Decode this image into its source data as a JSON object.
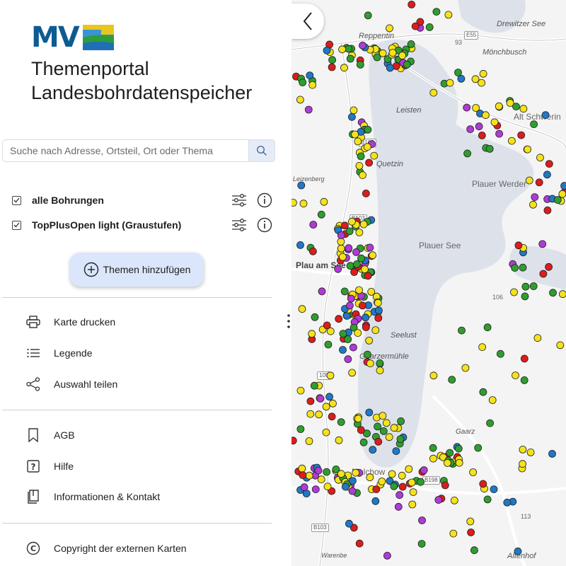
{
  "logo": {
    "text": "MV"
  },
  "header": {
    "title_line1": "Themenportal",
    "title_line2": "Landesbohrdatenspeicher"
  },
  "search": {
    "placeholder": "Suche nach Adresse, Ortsteil, Ort oder Thema",
    "icon": "search-icon"
  },
  "layers": [
    {
      "label": "alle Bohrungen",
      "checked": true
    },
    {
      "label": "TopPlusOpen light (Graustufen)",
      "checked": true
    }
  ],
  "add_button": {
    "label": "Themen hinzufügen"
  },
  "menu1": [
    {
      "label": "Karte drucken",
      "icon": "printer-icon"
    },
    {
      "label": "Legende",
      "icon": "list-icon"
    },
    {
      "label": "Auswahl teilen",
      "icon": "share-icon"
    }
  ],
  "menu2": [
    {
      "label": "AGB",
      "icon": "bookmark-icon"
    },
    {
      "label": "Hilfe",
      "icon": "help-icon"
    },
    {
      "label": "Informationen & Kontakt",
      "icon": "book-icon"
    }
  ],
  "menu3": [
    {
      "label": "Copyright der externen Karten",
      "icon": "copyright-icon"
    }
  ],
  "map": {
    "places": [
      {
        "text": "Drewitzer See"
      },
      {
        "text": "Mönchbusch"
      },
      {
        "text": "Alt Schwerin"
      },
      {
        "text": "Leisten"
      },
      {
        "text": "Quetzin"
      },
      {
        "text": "Plauer Werder"
      },
      {
        "text": "Plauer See"
      },
      {
        "text": "Plau am See"
      },
      {
        "text": "Seelust"
      },
      {
        "text": "Gaarzermühle"
      },
      {
        "text": "Malchow"
      },
      {
        "text": "Altenhof"
      },
      {
        "text": "Reppentin"
      },
      {
        "text": "Leizenberg"
      },
      {
        "text": "Warenbe"
      },
      {
        "text": "Gaarz"
      }
    ],
    "roads": [
      "E55",
      "B103",
      "B103",
      "B198",
      "B103",
      "109"
    ],
    "elevations": [
      "93",
      "106",
      "113"
    ],
    "colors": {
      "red": "#dd1c1c",
      "yellow": "#f5e21a",
      "green": "#2e9e2e",
      "blue": "#1f78c8",
      "purple": "#b03ad6",
      "water": "#dde1ea",
      "land": "#f4f4f4",
      "road": "#ffffff"
    }
  }
}
